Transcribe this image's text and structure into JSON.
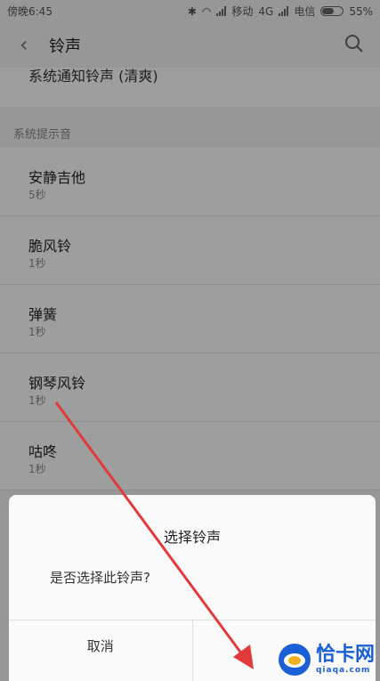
{
  "status_bar": {
    "time": "傍晚6:45",
    "carrier1": "移动",
    "network": "4G",
    "carrier2": "电信",
    "battery": "55%"
  },
  "header": {
    "title": "铃声"
  },
  "partial_item": "系统通知铃声 (清爽)",
  "section_header": "系统提示音",
  "ringtones": [
    {
      "name": "安静吉他",
      "duration": "5秒"
    },
    {
      "name": "脆风铃",
      "duration": "1秒"
    },
    {
      "name": "弹簧",
      "duration": "1秒"
    },
    {
      "name": "钢琴风铃",
      "duration": "1秒"
    },
    {
      "name": "咕咚",
      "duration": "1秒"
    }
  ],
  "dialog": {
    "title": "选择铃声",
    "message": "是否选择此铃声?",
    "cancel": "取消",
    "confirm": ""
  },
  "watermark": {
    "name": "恰卡网",
    "url": "qiaqa.com"
  },
  "colors": {
    "arrow": "#e03a3a",
    "watermark": "#1a5fd6"
  }
}
